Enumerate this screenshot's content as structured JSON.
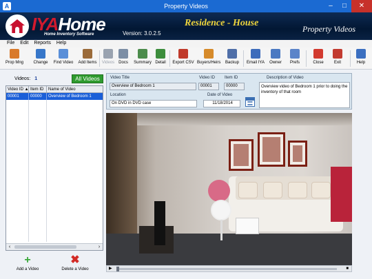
{
  "window": {
    "title": "Property Videos"
  },
  "banner": {
    "logo_prefix": "IYA",
    "logo_main": "Home",
    "logo_sub": "Home Inventory Software",
    "version": "Version: 3.0.2.5",
    "collection": "Residence - House",
    "section": "Property Videos"
  },
  "menu": [
    "File",
    "Edit",
    "Reports",
    "Help"
  ],
  "toolbar": [
    {
      "label": "Prop Mng",
      "icon": "people-icon",
      "color": "#d97a2b"
    },
    {
      "label": "Change",
      "icon": "person-icon",
      "color": "#3777c9"
    },
    {
      "label": "Find Video",
      "icon": "magnifier-icon",
      "color": "#5a8fd8"
    },
    {
      "label": "Add Items",
      "icon": "box-icon",
      "color": "#9b6b3a"
    },
    {
      "label": "Videos",
      "icon": "film-icon",
      "color": "#9aa3b0"
    },
    {
      "label": "Docs",
      "icon": "document-icon",
      "color": "#7c8ea5"
    },
    {
      "label": "Summary",
      "icon": "clipboard-icon",
      "color": "#4c8c4c"
    },
    {
      "label": "Detail",
      "icon": "chart-icon",
      "color": "#3c8d3c"
    },
    {
      "label": "Export CSV",
      "icon": "export-arrow-icon",
      "color": "#c03a2b"
    },
    {
      "label": "Buyers/Heirs",
      "icon": "group-icon",
      "color": "#d68a2a"
    },
    {
      "label": "Backup",
      "icon": "disk-icon",
      "color": "#4f6fa8"
    },
    {
      "label": "Email IYA",
      "icon": "envelope-icon",
      "color": "#3d6cbb"
    },
    {
      "label": "Owner",
      "icon": "owner-icon",
      "color": "#4a79c2"
    },
    {
      "label": "Prefs",
      "icon": "gear-icon",
      "color": "#5b84c9"
    },
    {
      "label": "Close",
      "icon": "close-circle-icon",
      "color": "#d23a2f"
    },
    {
      "label": "Exit",
      "icon": "exit-door-icon",
      "color": "#c23b30"
    },
    {
      "label": "Help",
      "icon": "help-icon",
      "color": "#3b6fc0"
    }
  ],
  "left": {
    "videos_label": "Videos:",
    "videos_count": "1",
    "all_videos": "All Videos",
    "columns": [
      "Video ID",
      "Item ID",
      "Name of Video"
    ],
    "rows": [
      {
        "video_id": "00001",
        "item_id": "00000",
        "name": "Overview of Bedroom 1"
      }
    ],
    "add_video": "Add a Video",
    "delete_video": "Delete a Video"
  },
  "details": {
    "title_label": "Video Title",
    "title_value": "Overview of Bedroom 1",
    "video_id_label": "Video ID",
    "video_id_value": "00001",
    "item_id_label": "Item ID",
    "item_id_value": "00000",
    "description_label": "Description of Video",
    "description_value": "Overview video of Bedroom 1 prior to doing the inventory of that room",
    "location_label": "Location",
    "location_value": "On DVD in DVD case",
    "date_label": "Date of Video",
    "date_value": "11/18/2014"
  }
}
